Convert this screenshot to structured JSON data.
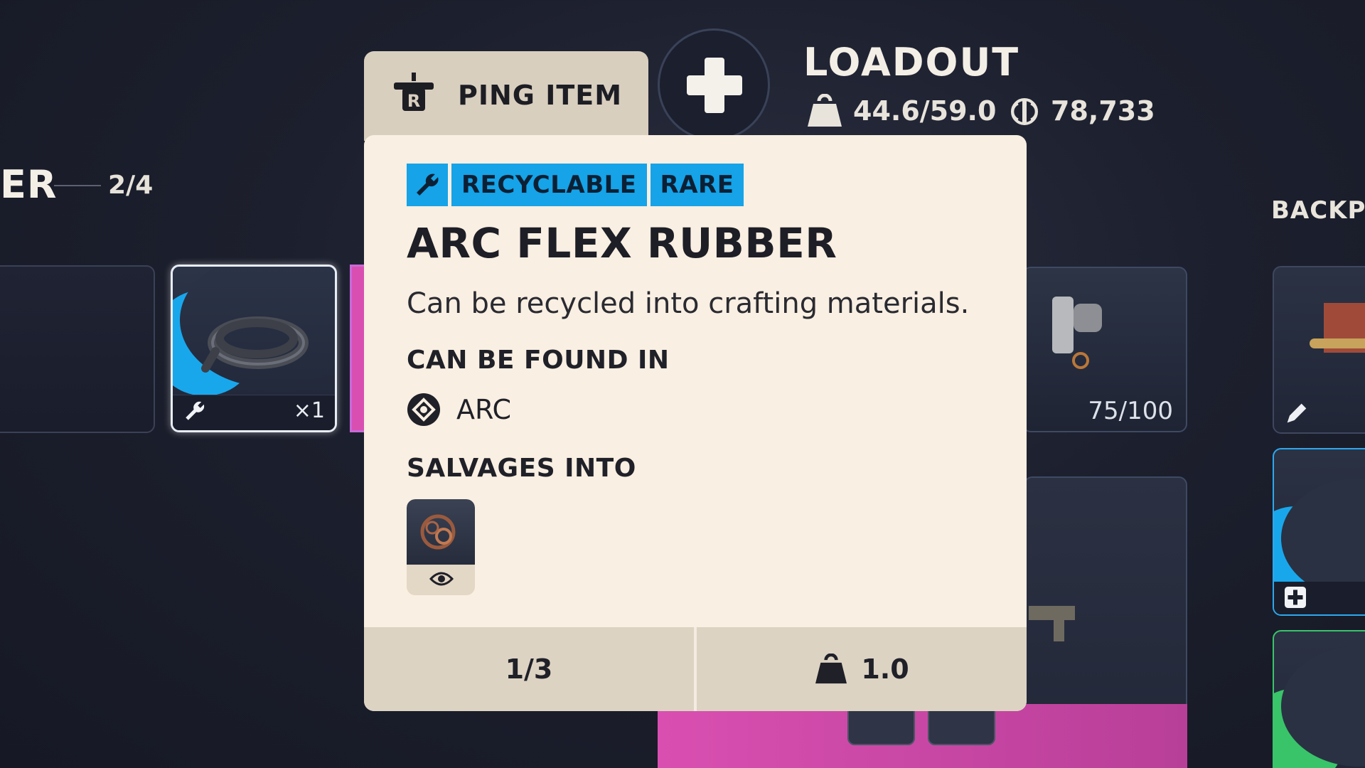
{
  "stash": {
    "title_fragment": "ER",
    "count": "2/4",
    "selected_slot": {
      "quantity": "×1"
    },
    "right_slot": {
      "durability": "75/100"
    }
  },
  "backpack": {
    "label": "BACKP"
  },
  "loadout": {
    "title": "LOADOUT",
    "weight": "44.6/59.0",
    "currency": "78,733"
  },
  "ping": {
    "label": "PING ITEM",
    "key": "R"
  },
  "item": {
    "tags": [
      "RECYCLABLE",
      "RARE"
    ],
    "name": "ARC FLEX RUBBER",
    "description": "Can be recycled into crafting materials.",
    "found_label": "CAN BE FOUND IN",
    "found_in": "ARC",
    "salvage_label": "SALVAGES INTO",
    "stack": "1/3",
    "weight": "1.0"
  },
  "colors": {
    "rarity_rare": "#16a3e8",
    "card_bg": "#f9efe2",
    "footer_bg": "#ddd3c3",
    "epic_pink": "#d94fb1",
    "uncommon_green": "#39c46a"
  }
}
